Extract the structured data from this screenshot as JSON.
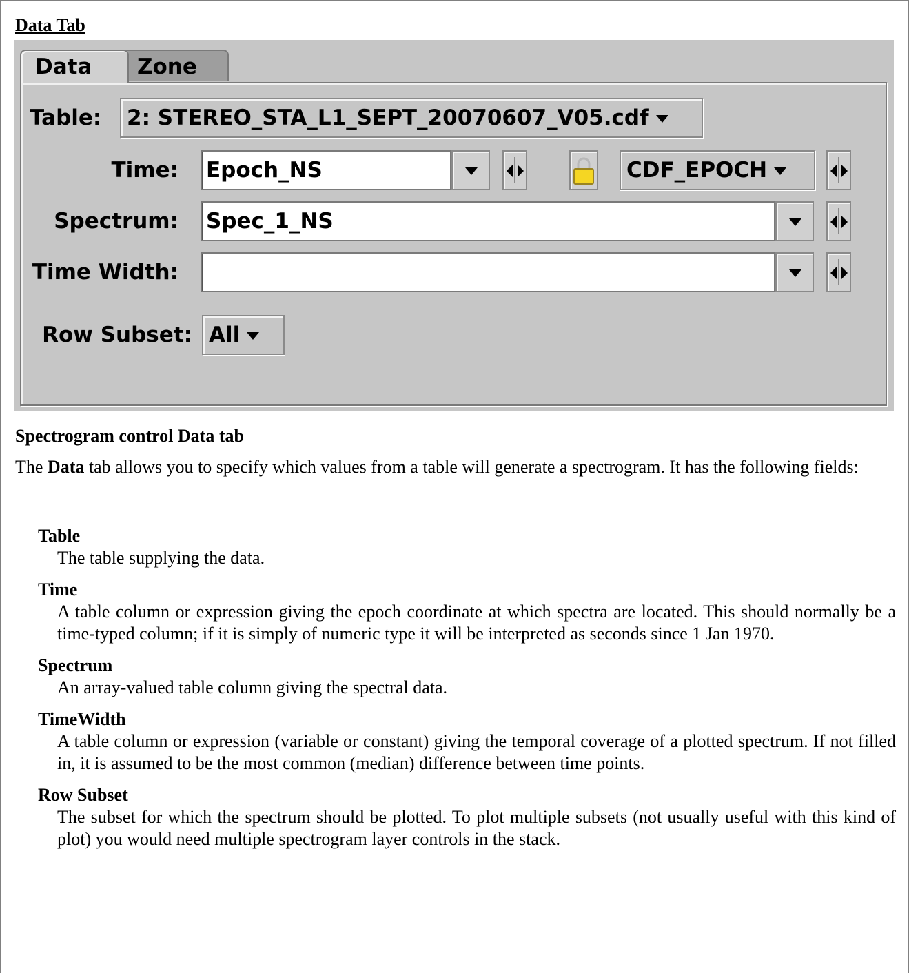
{
  "doc_title": "Data Tab",
  "tabs": [
    {
      "label": "Data"
    },
    {
      "label": "Zone"
    }
  ],
  "form": {
    "table_label": "Table:",
    "table_value": "2: STEREO_STA_L1_SEPT_20070607_V05.cdf",
    "time_label": "Time:",
    "time_value": "Epoch_NS",
    "time_format": "CDF_EPOCH",
    "spectrum_label": "Spectrum:",
    "spectrum_value": "Spec_1_NS",
    "timewidth_label": "Time Width:",
    "timewidth_value": "",
    "rowsubset_label": "Row Subset:",
    "rowsubset_value": "All"
  },
  "caption": "Spectrogram control Data tab",
  "intro": {
    "pre": "The ",
    "bold": "Data",
    "post": " tab allows you to specify which values from a table will generate a spectrogram. It has the following fields:"
  },
  "fields": [
    {
      "term": "Table",
      "desc": "The table supplying the data."
    },
    {
      "term": "Time",
      "desc": "A table column or expression giving the epoch coordinate at which spectra are located. This should normally be a time-typed column; if it is simply of numeric type it will be interpreted as seconds since 1 Jan 1970."
    },
    {
      "term": "Spectrum",
      "desc": "An array-valued table column giving the spectral data."
    },
    {
      "term": "TimeWidth",
      "desc": "A table column or expression (variable or constant) giving the temporal coverage of a plotted spectrum. If not filled in, it is assumed to be the most common (median) difference between time points."
    },
    {
      "term": "Row Subset",
      "desc": "The subset for which the spectrum should be plotted. To plot multiple subsets (not usually useful with this kind of plot) you would need multiple spectrogram layer controls in the stack."
    }
  ],
  "icons": {
    "lock": "padlock-icon",
    "dropdown": "triangle-down-icon",
    "prev_next": "arrow-left-right-icon"
  },
  "colors": {
    "panel": "#c6c6c6",
    "lock_body": "#f5d623"
  }
}
